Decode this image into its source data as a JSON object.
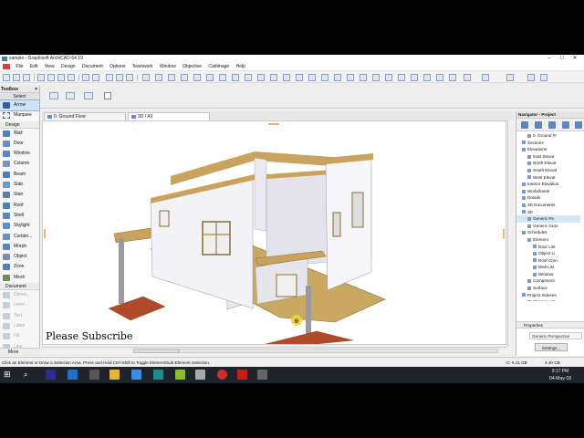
{
  "window": {
    "title": "sample - Graphisoft ArchiCAD-64 19",
    "controls": [
      "–",
      "□",
      "✕"
    ]
  },
  "menu": [
    "File",
    "Edit",
    "View",
    "Design",
    "Document",
    "Options",
    "Teamwork",
    "Window",
    "Objective",
    "Cadimage",
    "Help"
  ],
  "toolbox": {
    "title": "Toolbox",
    "select_label": "Select",
    "arrow_label": "Arrow",
    "marquee_label": "Marquee",
    "design_label": "Design",
    "design_tools": [
      "Wall",
      "Door",
      "Window",
      "Column",
      "Beam",
      "Slab",
      "Stair",
      "Roof",
      "Shell",
      "Skylight",
      "Curtain...",
      "Morph",
      "Object",
      "Zone",
      "Mesh"
    ],
    "document_label": "Document",
    "document_tools": [
      "Dimen...",
      "Level ...",
      "Text",
      "Label",
      "Fill",
      "Line"
    ],
    "more_label": "More"
  },
  "tabs": [
    {
      "label": "0. Ground Floor",
      "active": false
    },
    {
      "label": "3D / All",
      "active": true
    }
  ],
  "viewport": {
    "overlay_text": "Please Subscribe"
  },
  "navigator": {
    "title": "Navigator - Project",
    "tree": [
      {
        "label": "0. Ground Fl",
        "indent": 4,
        "sel": false
      },
      {
        "label": "Sections",
        "indent": 2,
        "sel": false
      },
      {
        "label": "Elevations",
        "indent": 2,
        "sel": false
      },
      {
        "label": "East Elevat",
        "indent": 4,
        "sel": false
      },
      {
        "label": "North Elevat",
        "indent": 4,
        "sel": false
      },
      {
        "label": "South Elevat",
        "indent": 4,
        "sel": false
      },
      {
        "label": "West Elevat",
        "indent": 4,
        "sel": false
      },
      {
        "label": "Interior Elevation",
        "indent": 2,
        "sel": false
      },
      {
        "label": "Worksheets",
        "indent": 2,
        "sel": false
      },
      {
        "label": "Details",
        "indent": 2,
        "sel": false
      },
      {
        "label": "3D Documents",
        "indent": 2,
        "sel": false
      },
      {
        "label": "3D",
        "indent": 2,
        "sel": false
      },
      {
        "label": "Generic Pe",
        "indent": 4,
        "sel": true
      },
      {
        "label": "Generic Axon",
        "indent": 4,
        "sel": false
      },
      {
        "label": "Schedules",
        "indent": 2,
        "sel": false
      },
      {
        "label": "Element",
        "indent": 4,
        "sel": false
      },
      {
        "label": "Door List",
        "indent": 6,
        "sel": false
      },
      {
        "label": "Object Li",
        "indent": 6,
        "sel": false
      },
      {
        "label": "Roof Com",
        "indent": 6,
        "sel": false
      },
      {
        "label": "Wall List",
        "indent": 6,
        "sel": false
      },
      {
        "label": "Window",
        "indent": 6,
        "sel": false
      },
      {
        "label": "Component",
        "indent": 4,
        "sel": false
      },
      {
        "label": "Surface",
        "indent": 4,
        "sel": false
      },
      {
        "label": "Project Indexes",
        "indent": 2,
        "sel": false
      },
      {
        "label": "Change List",
        "indent": 4,
        "sel": false
      }
    ],
    "properties_label": "Properties",
    "properties_value": "Generic Perspective",
    "settings_label": "Settings..."
  },
  "statusbar": {
    "message": "Click an Element or Draw a Selection Area. Press and Hold Ctrl+Shift to Toggle Element/Sub-Element Selection.",
    "c_drive": "C: 9.21 GB",
    "memory": "4.30 GB"
  },
  "taskbar": {
    "time": "9:17 PM",
    "date": "04-May-18"
  }
}
